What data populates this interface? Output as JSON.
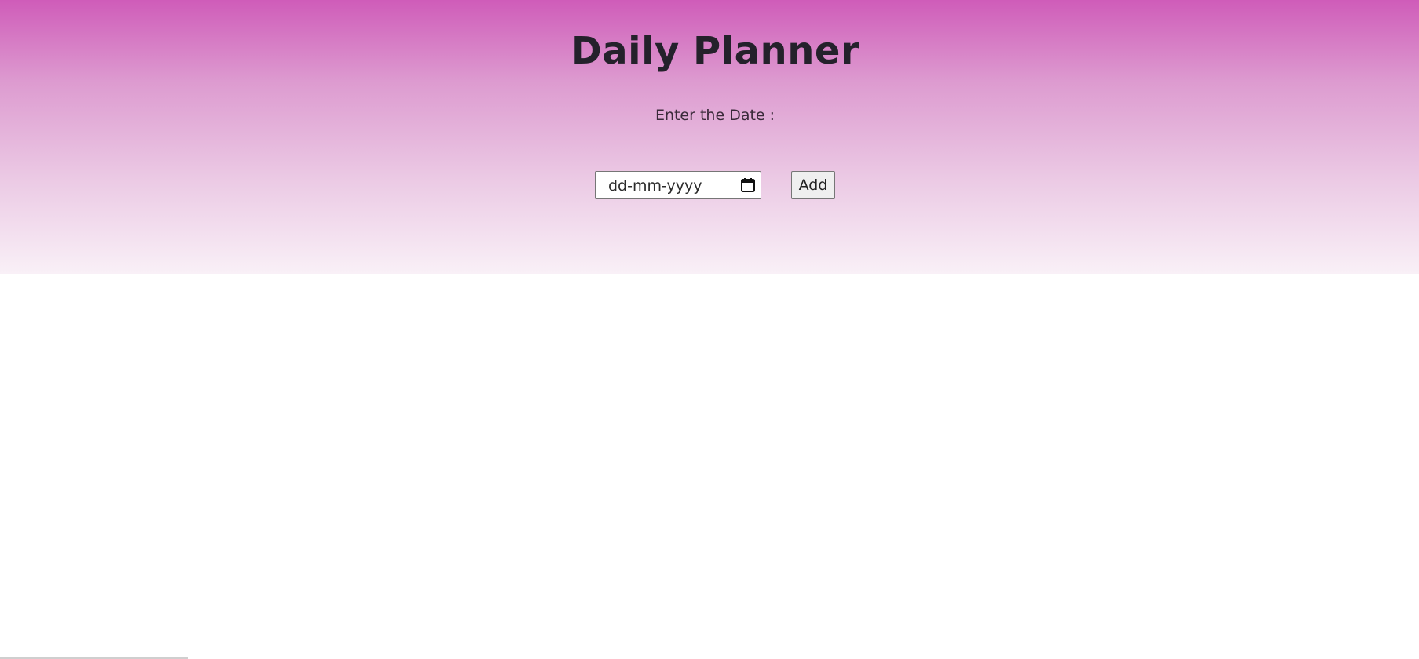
{
  "page": {
    "title": "Daily Planner",
    "date_label": "Enter the Date :"
  },
  "date_input": {
    "placeholder": "dd-mm-yyyy",
    "icon": "calendar-icon"
  },
  "add_button": {
    "label": "Add"
  },
  "colors": {
    "gradient_top": "#cf5cb9",
    "gradient_bottom": "#f9f0f7",
    "text": "#24212b"
  }
}
